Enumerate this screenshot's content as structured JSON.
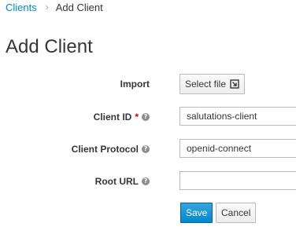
{
  "breadcrumb": {
    "parent": "Clients",
    "separator": "›",
    "current": "Add Client"
  },
  "page": {
    "title": "Add Client"
  },
  "form": {
    "import": {
      "label": "Import",
      "button_label": "Select file",
      "icon": "import-icon"
    },
    "client_id": {
      "label": "Client ID",
      "required_marker": "*",
      "help_icon": "?",
      "value": "salutations-client"
    },
    "client_protocol": {
      "label": "Client Protocol",
      "help_icon": "?",
      "value": "openid-connect"
    },
    "root_url": {
      "label": "Root URL",
      "help_icon": "?",
      "value": ""
    },
    "actions": {
      "save_label": "Save",
      "cancel_label": "Cancel"
    }
  },
  "colors": {
    "link": "#0088ce",
    "primary_button": "#0088ce",
    "required": "#cc0000",
    "text": "#363636"
  }
}
